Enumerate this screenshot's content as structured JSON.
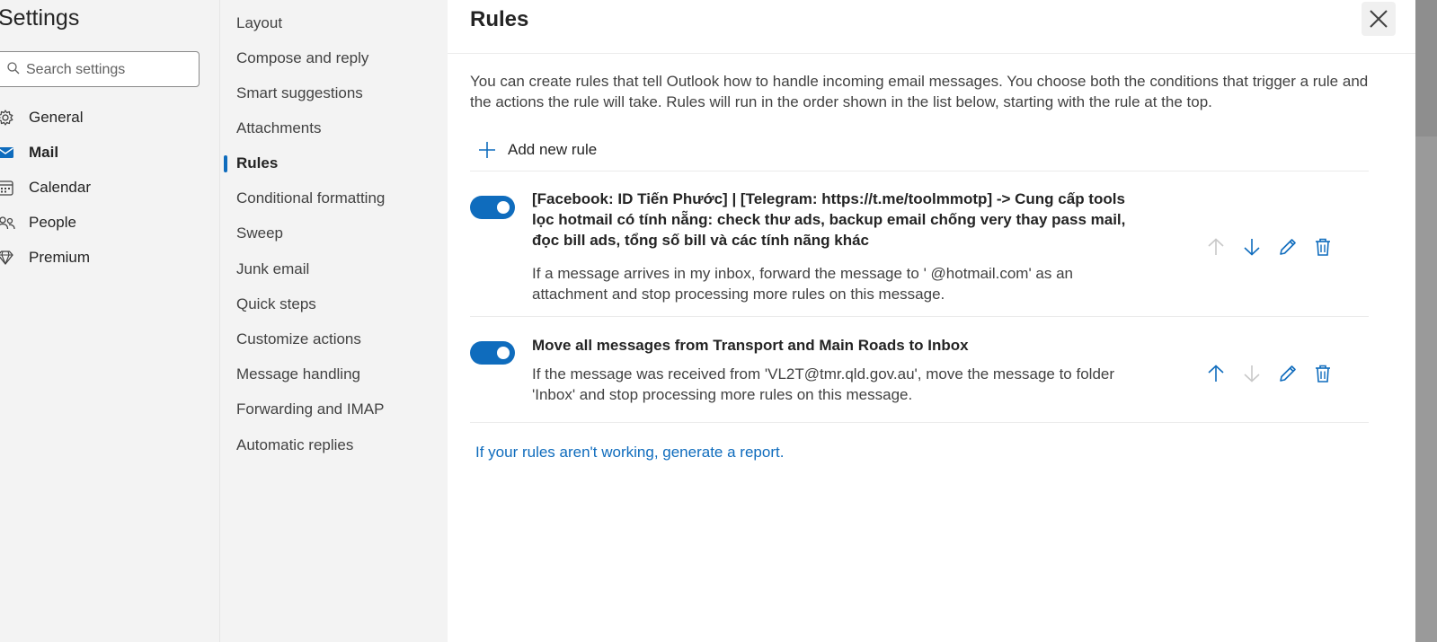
{
  "settings": {
    "title": "Settings",
    "search_placeholder": "Search settings",
    "categories": [
      {
        "label": "General",
        "icon": "gear-icon"
      },
      {
        "label": "Mail",
        "icon": "mail-icon"
      },
      {
        "label": "Calendar",
        "icon": "calendar-icon"
      },
      {
        "label": "People",
        "icon": "people-icon"
      },
      {
        "label": "Premium",
        "icon": "diamond-icon"
      }
    ],
    "active_category": "Mail"
  },
  "mail_nav": {
    "items": [
      {
        "label": "Layout"
      },
      {
        "label": "Compose and reply"
      },
      {
        "label": "Smart suggestions"
      },
      {
        "label": "Attachments"
      },
      {
        "label": "Rules"
      },
      {
        "label": "Conditional formatting"
      },
      {
        "label": "Sweep"
      },
      {
        "label": "Junk email"
      },
      {
        "label": "Quick steps"
      },
      {
        "label": "Customize actions"
      },
      {
        "label": "Message handling"
      },
      {
        "label": "Forwarding and IMAP"
      },
      {
        "label": "Automatic replies"
      }
    ],
    "active_item": "Rules"
  },
  "rules_panel": {
    "title": "Rules",
    "intro": "You can create rules that tell Outlook how to handle incoming email messages. You choose both the conditions that trigger a rule and the actions the rule will take. Rules will run in the order shown in the list below, starting with the rule at the top.",
    "add_rule_label": "Add new rule",
    "rules": [
      {
        "name": "[Facebook: ID Tiến Phước] | [Telegram: https://t.me/toolmmotp] -> Cung cấp tools lọc hotmail có tính nẵng: check thư ads, backup email chống very thay pass mail, đọc bill ads, tổng số bill và các tính nãng khác",
        "description": "If a message arrives in my inbox, forward the message to '    @hotmail.com' as an attachment and stop processing more rules on this message.",
        "enabled": true,
        "move_up_enabled": false,
        "move_down_enabled": true
      },
      {
        "name": "Move all messages from Transport and Main Roads to Inbox",
        "description": "If the message was received from 'VL2T@tmr.qld.gov.au', move the message to folder 'Inbox' and stop processing more rules on this message.",
        "enabled": true,
        "move_up_enabled": true,
        "move_down_enabled": false
      }
    ],
    "report_link": "If your rules aren't working, generate a report."
  },
  "colors": {
    "accent": "#0f6cbd",
    "disabled_icon": "#c8c8c8",
    "sidebar_bg": "#f3f3f3"
  }
}
